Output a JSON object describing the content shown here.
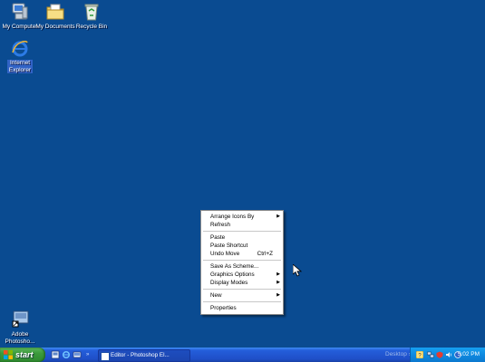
{
  "desktop": {
    "icons": [
      {
        "label": "My Computer"
      },
      {
        "label": "My Documents"
      },
      {
        "label": "Recycle Bin"
      },
      {
        "label": "Internet Explorer"
      },
      {
        "label": "Adobe Photosho..."
      }
    ]
  },
  "context_menu": {
    "items": {
      "arrange": "Arrange Icons By",
      "refresh": "Refresh",
      "paste": "Paste",
      "paste_shortcut": "Paste Shortcut",
      "undo_move": "Undo Move",
      "undo_move_shortcut": "Ctrl+Z",
      "save_as_scheme": "Save As Scheme...",
      "graphics_options": "Graphics Options",
      "display_modes": "Display Modes",
      "new": "New",
      "properties": "Properties"
    }
  },
  "taskbar": {
    "start_label": "start",
    "task_editor": "Editor - Photoshop El...",
    "desktop_toolbar_label": "Desktop",
    "clock": "5:02 PM",
    "chevron": "»"
  },
  "colors": {
    "desktop": "#0a4b91",
    "taskbar": "#245edb",
    "start": "#3c9a3c"
  }
}
